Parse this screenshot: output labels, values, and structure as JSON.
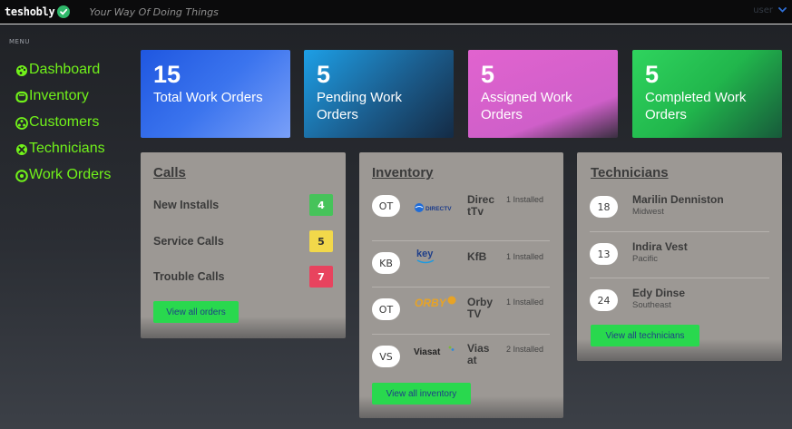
{
  "header": {
    "brand": "teshobly",
    "tagline": "Your Way Of Doing Things",
    "user_label": "user"
  },
  "sidebar": {
    "menu_label": "MENU",
    "items": [
      {
        "label": "Dashboard",
        "icon": "palette-icon"
      },
      {
        "label": "Inventory",
        "icon": "cup-icon"
      },
      {
        "label": "Customers",
        "icon": "users-icon"
      },
      {
        "label": "Technicians",
        "icon": "tools-icon"
      },
      {
        "label": "Work Orders",
        "icon": "chat-icon"
      }
    ]
  },
  "stats": [
    {
      "value": "15",
      "label": "Total Work Orders"
    },
    {
      "value": "5",
      "label": "Pending Work Orders"
    },
    {
      "value": "5",
      "label": "Assigned Work Orders"
    },
    {
      "value": "5",
      "label": "Completed Work Orders"
    }
  ],
  "calls": {
    "title": "Calls",
    "rows": [
      {
        "label": "New Installs",
        "count": "4",
        "color": "#46c35a"
      },
      {
        "label": "Service Calls",
        "count": "5",
        "color": "#f2d84a"
      },
      {
        "label": "Trouble Calls",
        "count": "7",
        "color": "#e8435e"
      }
    ],
    "button": "View all orders"
  },
  "inventory": {
    "title": "Inventory",
    "items": [
      {
        "code": "OT",
        "brand": "DIRECTV",
        "name": "Direc tTv",
        "count": "1 Installed"
      },
      {
        "code": "KB",
        "brand": "key",
        "name": "KfB",
        "count": "1 Installed"
      },
      {
        "code": "OT",
        "brand": "ORBY",
        "name": "Orby TV",
        "count": "1 Installed"
      },
      {
        "code": "VS",
        "brand": "Viasat",
        "name": "Vias at",
        "count": "2 Installed"
      }
    ],
    "button": "View all inventory"
  },
  "technicians": {
    "title": "Technicians",
    "items": [
      {
        "code": "18",
        "name": "Marilin Denniston",
        "region": "Midwest"
      },
      {
        "code": "13",
        "name": "Indira Vest",
        "region": "Pacific"
      },
      {
        "code": "24",
        "name": "Edy Dinse",
        "region": "Southeast"
      }
    ],
    "button": "View all technicians"
  }
}
